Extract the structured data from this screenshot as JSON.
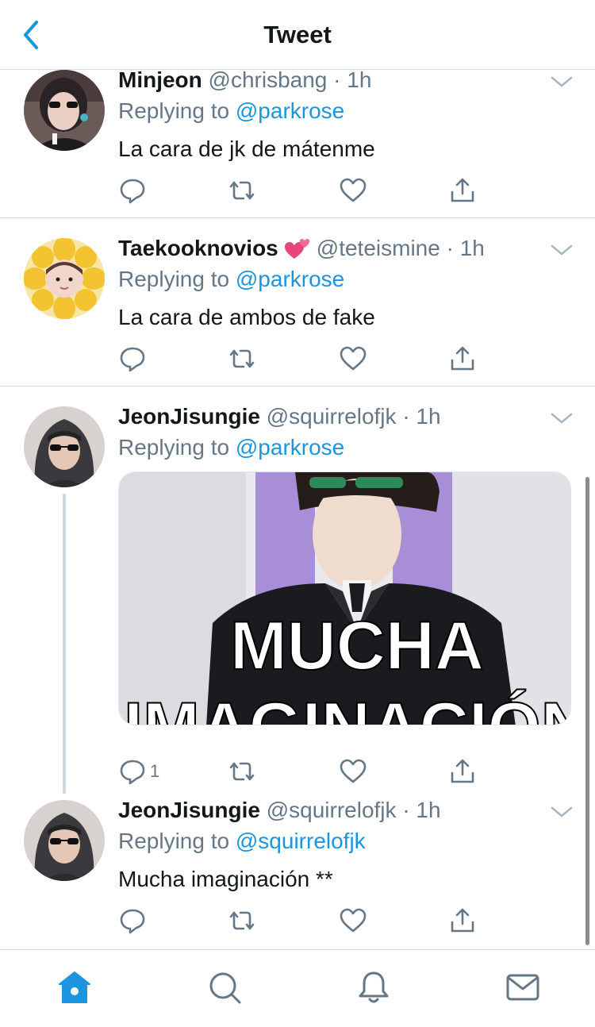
{
  "header": {
    "title": "Tweet"
  },
  "colors": {
    "accent": "#1b95e0",
    "secondary_text": "#657786",
    "divider": "#d8dde2"
  },
  "tweets": [
    {
      "display_name": "Minjeon",
      "handle": "@chrisbang",
      "time": "· 1h",
      "replying_prefix": "Replying to ",
      "replying_to": "@parkrose",
      "text": "La cara de jk de mátenme",
      "reply_count": ""
    },
    {
      "display_name": "Taekooknovios",
      "name_emoji": "two-hearts-emoji",
      "handle": "@teteismine",
      "time": "· 1h",
      "replying_prefix": "Replying to ",
      "replying_to": "@parkrose",
      "text": "La cara de ambos de fake",
      "reply_count": ""
    },
    {
      "display_name": "JeonJisungie",
      "handle": "@squirrelofjk",
      "time": "· 1h",
      "replying_prefix": "Replying to ",
      "replying_to": "@parkrose",
      "media_caption": "MUCHA",
      "media_caption_2": "IMAGINACIÓN",
      "reply_count": "1"
    },
    {
      "display_name": "JeonJisungie",
      "handle": "@squirrelofjk",
      "time": "· 1h",
      "replying_prefix": "Replying to ",
      "replying_to": "@squirrelofjk",
      "text": "Mucha imaginación **",
      "reply_count": ""
    }
  ],
  "tabbar": {
    "items": [
      "home-icon",
      "search-icon",
      "notifications-icon",
      "messages-icon"
    ],
    "active": "home-icon"
  }
}
